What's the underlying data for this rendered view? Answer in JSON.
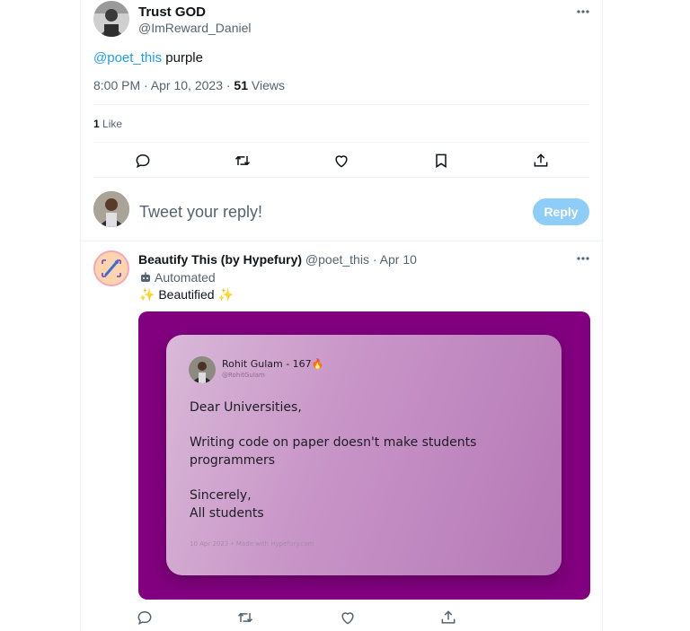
{
  "main_tweet": {
    "author_name": "Trust GOD",
    "author_handle": "@ImReward_Daniel",
    "mention": "@poet_this",
    "text_rest": " purple",
    "time": "8:00 PM · Apr 10, 2023 · ",
    "views_count": "51",
    "views_label": " Views",
    "likes_count": "1",
    "likes_label": " Like"
  },
  "reply_box": {
    "placeholder": "Tweet your reply!",
    "button_label": "Reply"
  },
  "reply_tweet": {
    "author_name": "Beautify This (by Hypefury)",
    "author_handle": "@poet_this",
    "separator": " · ",
    "date": "Apr 10",
    "automated_label": "Automated",
    "text": "✨ Beautified ✨",
    "card": {
      "name": "Rohit Gulam - 167🔥",
      "handle": "@RohitGulam",
      "line1": "Dear Universities,",
      "line2": "Writing code on paper doesn't make students",
      "line3": "programmers",
      "line4": "Sincerely,",
      "line5": "All students",
      "footer": "10 Apr 2023 • Made with Hypefury.com"
    }
  },
  "colors": {
    "accent": "#1d9bf0",
    "reply_button": "#8ecdf8",
    "card_background": "#82007f"
  }
}
